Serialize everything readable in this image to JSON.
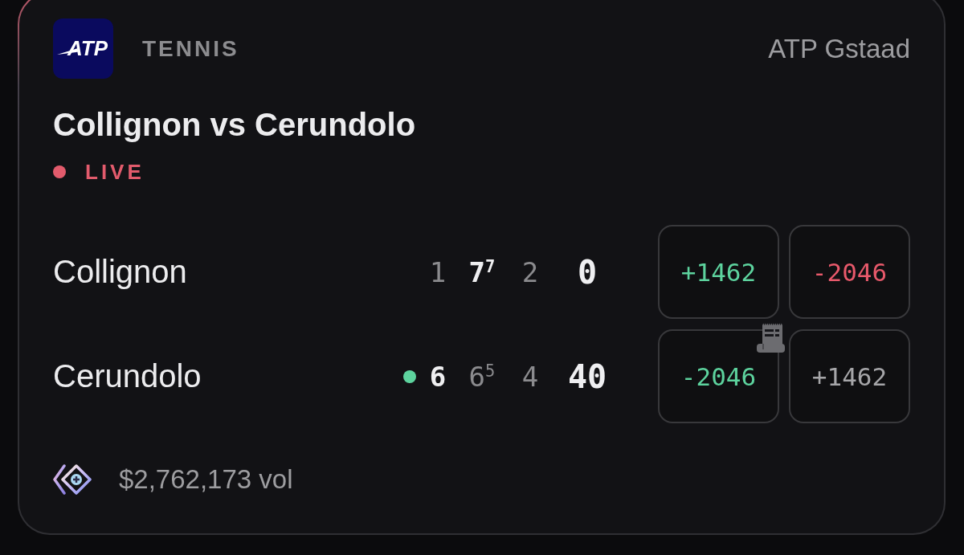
{
  "event": {
    "logo_text": "ATP",
    "sport": "TENNIS",
    "tournament": "ATP Gstaad",
    "title": "Collignon vs Cerundolo",
    "status": "LIVE"
  },
  "players": [
    {
      "name": "Collignon",
      "serving": false,
      "sets": [
        {
          "score": "1",
          "won": false
        },
        {
          "score": "7$^{7}$",
          "won": true
        },
        {
          "score": "2",
          "won": false
        }
      ],
      "points": "0",
      "odds": [
        {
          "value": "+1462",
          "color": "#5dd39e",
          "ticket": false
        },
        {
          "value": "-2046",
          "color": "#e8596b",
          "ticket": false
        }
      ]
    },
    {
      "name": "Cerundolo",
      "serving": true,
      "sets": [
        {
          "score": "6",
          "won": true
        },
        {
          "score": "6$^{5}$",
          "won": false
        },
        {
          "score": "4",
          "won": false
        }
      ],
      "points": "40",
      "odds": [
        {
          "value": "-2046",
          "color": "#5dd39e",
          "ticket": true
        },
        {
          "value": "+1462",
          "color": "#a6a6a9",
          "ticket": false
        }
      ]
    }
  ],
  "footer": {
    "volume": "$2,762,173 vol"
  }
}
